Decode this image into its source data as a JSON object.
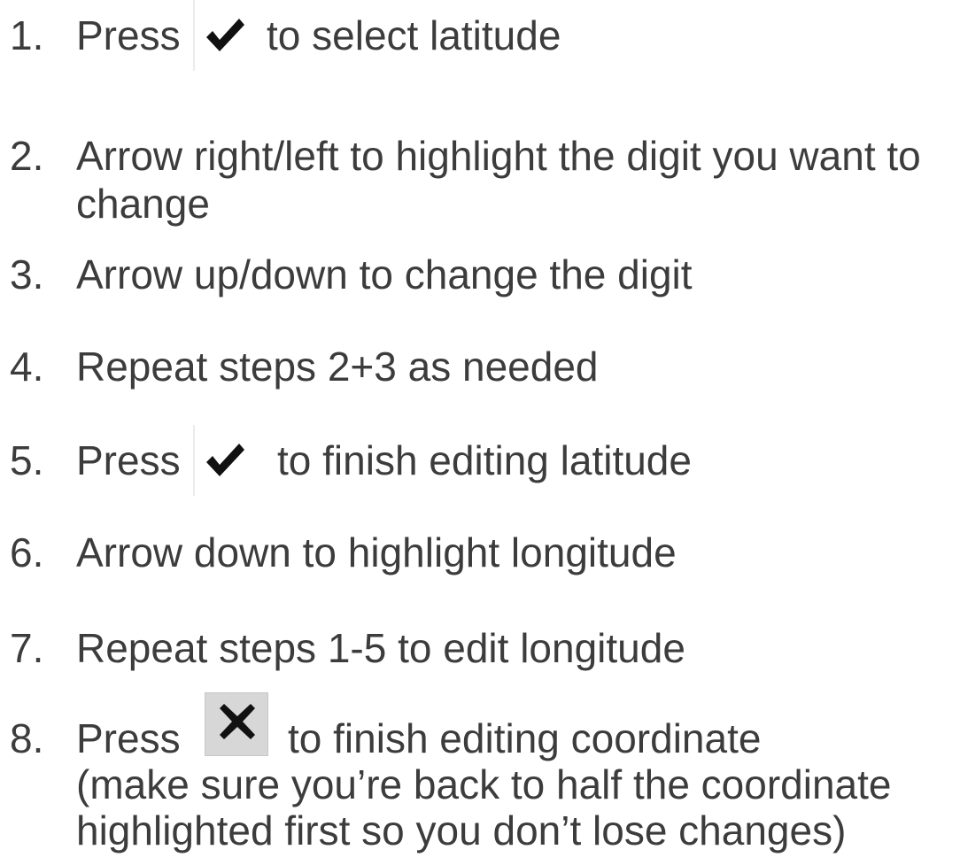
{
  "steps": [
    {
      "num": "1.",
      "before": "Press",
      "icon": "check-icon",
      "after": "to select latitude"
    },
    {
      "num": "2.",
      "line1": "Arrow right/left to highlight the digit you want to",
      "line2": "change"
    },
    {
      "num": "3.",
      "text": "Arrow up/down to change the digit"
    },
    {
      "num": "4.",
      "text": "Repeat steps 2+3 as needed"
    },
    {
      "num": "5.",
      "before": "Press",
      "icon": "check-icon",
      "after": "to finish editing latitude"
    },
    {
      "num": "6.",
      "text": "Arrow down to highlight longitude"
    },
    {
      "num": "7.",
      "text": "Repeat steps 1-5 to edit longitude"
    },
    {
      "num": "8.",
      "before": "Press",
      "icon": "close-icon",
      "after": "to finish editing coordinate",
      "line2": "(make sure you’re back to half the coordinate",
      "line3": "highlighted first so you don’t lose changes)"
    }
  ],
  "colors": {
    "text": "#3c3c3c",
    "icon": "#111111",
    "icon_bg": "#d7d7d7"
  }
}
